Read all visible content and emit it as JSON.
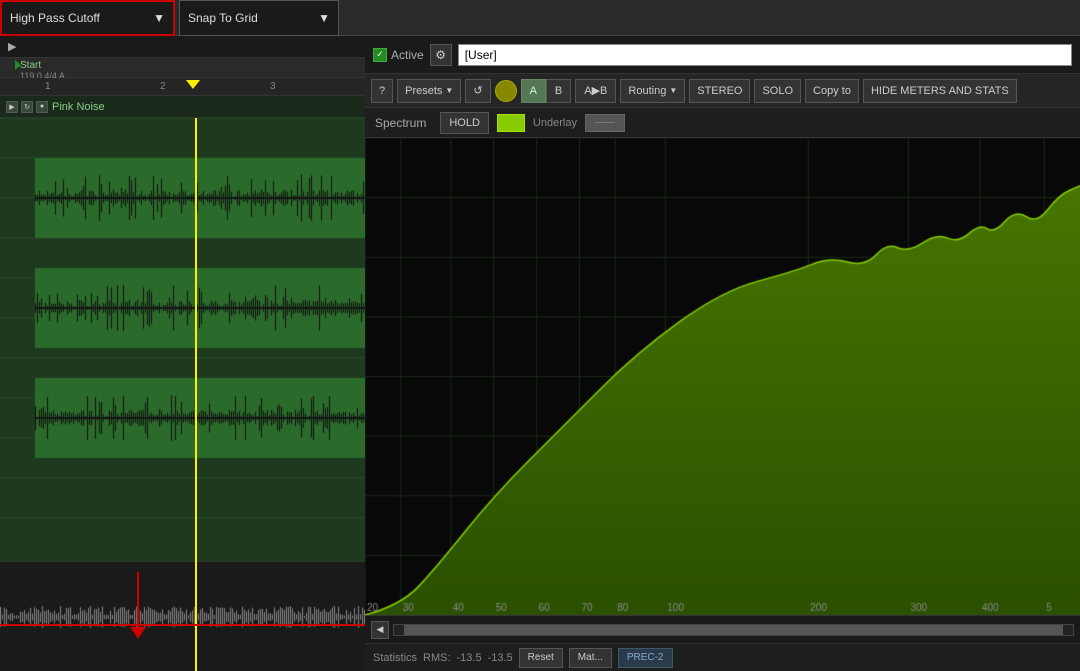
{
  "toolbar": {
    "high_pass_label": "High Pass Cutoff",
    "snap_label": "Snap To Grid",
    "dropdown_arrow": "▼"
  },
  "track": {
    "start_label": "Start",
    "bpm": "119.0 4/4 A",
    "track_name": "Pink Noise",
    "marker_1": "1",
    "marker_2": "2",
    "marker_3": "3"
  },
  "plugin": {
    "active_label": "Active",
    "user_label": "[User]",
    "question_btn": "?",
    "presets_label": "Presets",
    "reload_label": "↺",
    "btn_a": "A",
    "btn_b": "B",
    "btn_ab": "A▶B",
    "routing_label": "Routing",
    "stereo_label": "STEREO",
    "solo_label": "SOLO",
    "copy_to_label": "Copy to",
    "hide_meters_label": "HIDE METERS AND STATS",
    "spectrum_label": "Spectrum",
    "hold_label": "HOLD",
    "underlay_label": "Underlay",
    "underlay_dash": "——"
  },
  "stats": {
    "label": "Statistics",
    "rms_label": "RMS:",
    "rms_val": "-13.5",
    "rms_val2": "-13.5",
    "reset_label": "Reset",
    "match_label": "Mat...",
    "preset_label": "PREC-2"
  },
  "freq_labels": [
    "20",
    "30",
    "40",
    "50",
    "60",
    "70",
    "80",
    "100",
    "200",
    "300",
    "400",
    "5"
  ]
}
